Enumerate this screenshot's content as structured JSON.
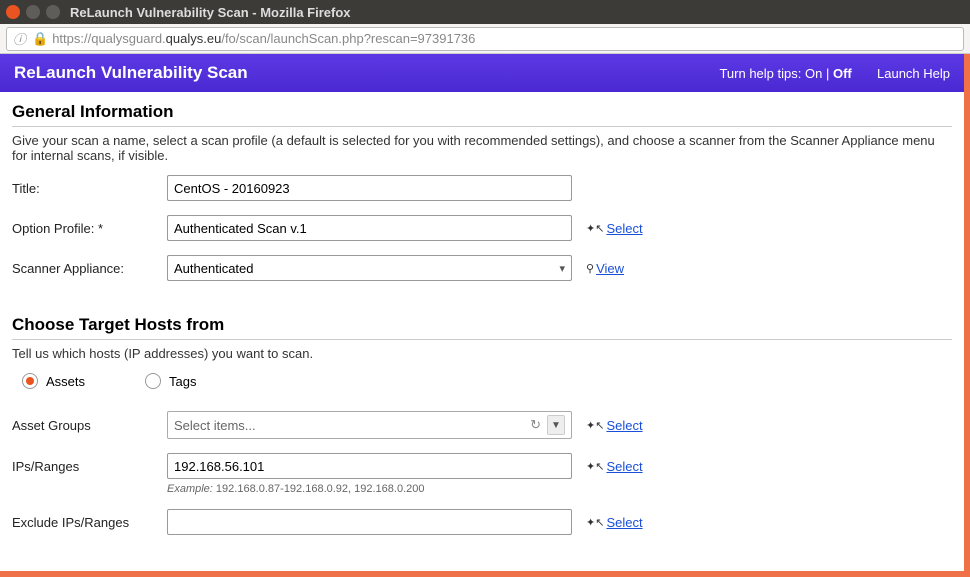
{
  "window": {
    "title": "ReLaunch Vulnerability Scan - Mozilla Firefox"
  },
  "url": {
    "prefix": "https://qualysguard.",
    "domain": "qualys.eu",
    "path": "/fo/scan/launchScan.php?rescan=97391736"
  },
  "header": {
    "title": "ReLaunch Vulnerability Scan",
    "help_tips_label": "Turn help tips:",
    "on": "On",
    "off": "Off",
    "launch_help": "Launch Help"
  },
  "section1": {
    "heading": "General Information",
    "desc": "Give your scan a name, select a scan profile (a default is selected for you with recommended settings), and choose a scanner from the Scanner Appliance menu for internal scans, if visible.",
    "title_label": "Title:",
    "title_value": "CentOS - 20160923",
    "profile_label": "Option Profile: *",
    "profile_value": "Authenticated Scan v.1",
    "select_link": "Select",
    "scanner_label": "Scanner Appliance:",
    "scanner_value": "Authenticated",
    "view_link": "View"
  },
  "section2": {
    "heading": "Choose Target Hosts from",
    "desc": "Tell us which hosts (IP addresses) you want to scan.",
    "radio_assets": "Assets",
    "radio_tags": "Tags",
    "asset_groups_label": "Asset Groups",
    "asset_groups_placeholder": "Select items...",
    "select_link": "Select",
    "ips_label": "IPs/Ranges",
    "ips_value": "192.168.56.101",
    "example_label": "Example:",
    "example_value": "192.168.0.87-192.168.0.92, 192.168.0.200",
    "exclude_label": "Exclude IPs/Ranges",
    "exclude_value": ""
  }
}
